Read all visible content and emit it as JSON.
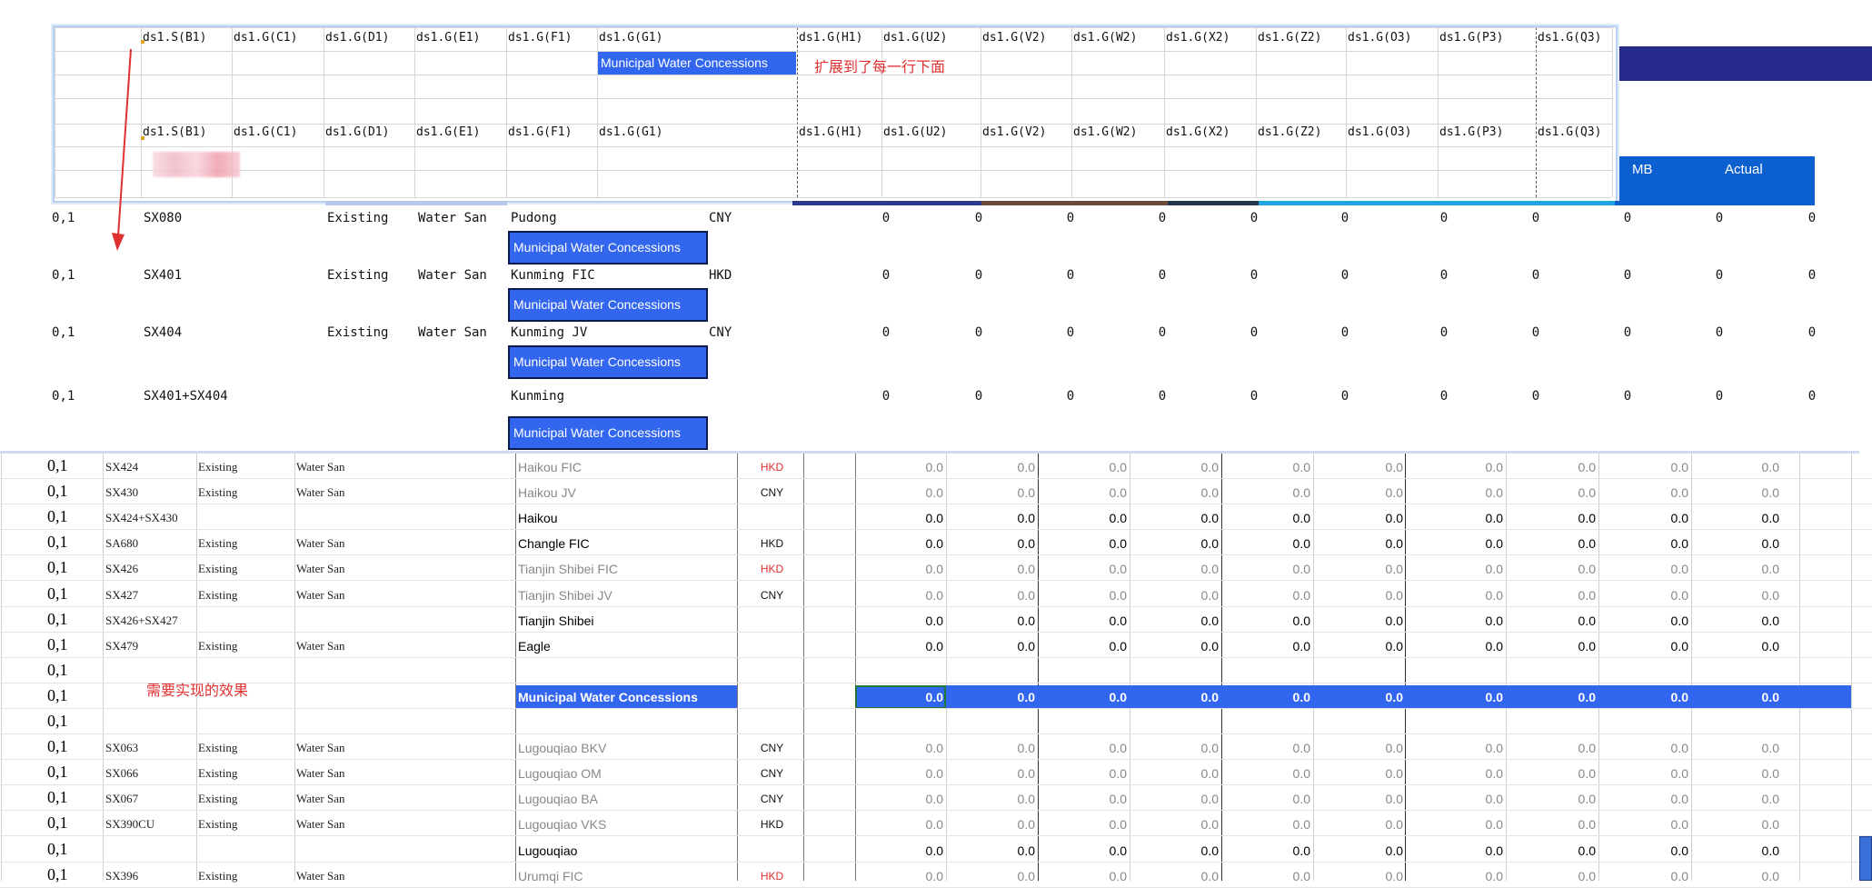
{
  "template_headers": [
    "ds1.S(B1)",
    "ds1.G(C1)",
    "ds1.G(D1)",
    "ds1.G(E1)",
    "ds1.G(F1)",
    "ds1.G(G1)",
    "ds1.G(H1)",
    "ds1.G(U2)",
    "ds1.G(V2)",
    "ds1.G(W2)",
    "ds1.G(X2)",
    "ds1.G(Z2)",
    "ds1.G(O3)",
    "ds1.G(P3)",
    "ds1.G(Q3)"
  ],
  "template_group_label": "Municipal Water Concessions",
  "annotation_expand": "扩展到了每一行下面",
  "annotation_desired": "需要实现的效果",
  "header_band": {
    "mb": "MB",
    "actual": "Actual"
  },
  "preview_rows": [
    {
      "flag": "0,1",
      "code": "SX080",
      "status": "Existing",
      "type": "Water San",
      "name": "Pudong",
      "currency": "CNY",
      "group": "Municipal Water Concessions"
    },
    {
      "flag": "0,1",
      "code": "SX401",
      "status": "Existing",
      "type": "Water San",
      "name": "Kunming FIC",
      "currency": "HKD",
      "group": "Municipal Water Concessions"
    },
    {
      "flag": "0,1",
      "code": "SX404",
      "status": "Existing",
      "type": "Water San",
      "name": "Kunming JV",
      "currency": "CNY",
      "group": "Municipal Water Concessions"
    },
    {
      "flag": "0,1",
      "code": "SX401+SX404",
      "status": "",
      "type": "",
      "name": "Kunming",
      "currency": "",
      "group": "Municipal Water Concessions"
    }
  ],
  "preview_value": "0",
  "sheet_value": "0.0",
  "sheet_rows": [
    {
      "flag": "0,1",
      "code": "SX424",
      "status": "Existing",
      "type": "Water San",
      "name": "Haikou FIC",
      "currency": "HKD",
      "style": "muted",
      "cur_color": "red",
      "nums": true
    },
    {
      "flag": "0,1",
      "code": "SX430",
      "status": "Existing",
      "type": "Water San",
      "name": "Haikou JV",
      "currency": "CNY",
      "style": "muted",
      "cur_color": "blk",
      "nums": true
    },
    {
      "flag": "0,1",
      "code": "SX424+SX430",
      "status": "",
      "type": "",
      "name": "Haikou",
      "currency": "",
      "style": "bold",
      "cur_color": "blk",
      "nums": true
    },
    {
      "flag": "0,1",
      "code": "SA680",
      "status": "Existing",
      "type": "Water San",
      "name": "Changle FIC",
      "currency": "HKD",
      "style": "bold",
      "cur_color": "blk",
      "nums": true
    },
    {
      "flag": "0,1",
      "code": "SX426",
      "status": "Existing",
      "type": "Water San",
      "name": "Tianjin Shibei FIC",
      "currency": "HKD",
      "style": "muted",
      "cur_color": "red",
      "nums": true
    },
    {
      "flag": "0,1",
      "code": "SX427",
      "status": "Existing",
      "type": "Water San",
      "name": "Tianjin Shibei JV",
      "currency": "CNY",
      "style": "muted",
      "cur_color": "blk",
      "nums": true
    },
    {
      "flag": "0,1",
      "code": "SX426+SX427",
      "status": "",
      "type": "",
      "name": "Tianjin Shibei",
      "currency": "",
      "style": "bold",
      "cur_color": "blk",
      "nums": true
    },
    {
      "flag": "0,1",
      "code": "SX479",
      "status": "Existing",
      "type": "Water San",
      "name": "Eagle",
      "currency": "",
      "style": "bold",
      "cur_color": "blk",
      "nums": true
    },
    {
      "flag": "0,1",
      "code": "",
      "status": "",
      "type": "",
      "name": "",
      "currency": "",
      "style": "bold",
      "cur_color": "blk",
      "nums": false
    },
    {
      "flag": "0,1",
      "code": "",
      "status": "",
      "type": "",
      "name": "Municipal Water Concessions",
      "currency": "",
      "style": "group",
      "cur_color": "blk",
      "nums": true
    },
    {
      "flag": "0,1",
      "code": "",
      "status": "",
      "type": "",
      "name": "",
      "currency": "",
      "style": "bold",
      "cur_color": "blk",
      "nums": false
    },
    {
      "flag": "0,1",
      "code": "SX063",
      "status": "Existing",
      "type": "Water San",
      "name": "Lugouqiao BKV",
      "currency": "CNY",
      "style": "muted",
      "cur_color": "blk",
      "nums": true
    },
    {
      "flag": "0,1",
      "code": "SX066",
      "status": "Existing",
      "type": "Water San",
      "name": "Lugouqiao OM",
      "currency": "CNY",
      "style": "muted",
      "cur_color": "blk",
      "nums": true
    },
    {
      "flag": "0,1",
      "code": "SX067",
      "status": "Existing",
      "type": "Water San",
      "name": "Lugouqiao BA",
      "currency": "CNY",
      "style": "muted",
      "cur_color": "blk",
      "nums": true
    },
    {
      "flag": "0,1",
      "code": "SX390CU",
      "status": "Existing",
      "type": "Water San",
      "name": "Lugouqiao VKS",
      "currency": "HKD",
      "style": "muted",
      "cur_color": "blk",
      "nums": true
    },
    {
      "flag": "0,1",
      "code": "",
      "status": "",
      "type": "",
      "name": "Lugouqiao",
      "currency": "",
      "style": "bold",
      "cur_color": "blk",
      "nums": true
    },
    {
      "flag": "0,1",
      "code": "SX396",
      "status": "Existing",
      "type": "Water San",
      "name": "Urumqi FIC",
      "currency": "HKD",
      "style": "muted",
      "cur_color": "red",
      "nums": true
    }
  ],
  "colors": {
    "group_blue": "#3366ee",
    "dark_navy": "#262a8a",
    "header_blue": "#0b5fcf",
    "arrow_red": "#e03030"
  }
}
